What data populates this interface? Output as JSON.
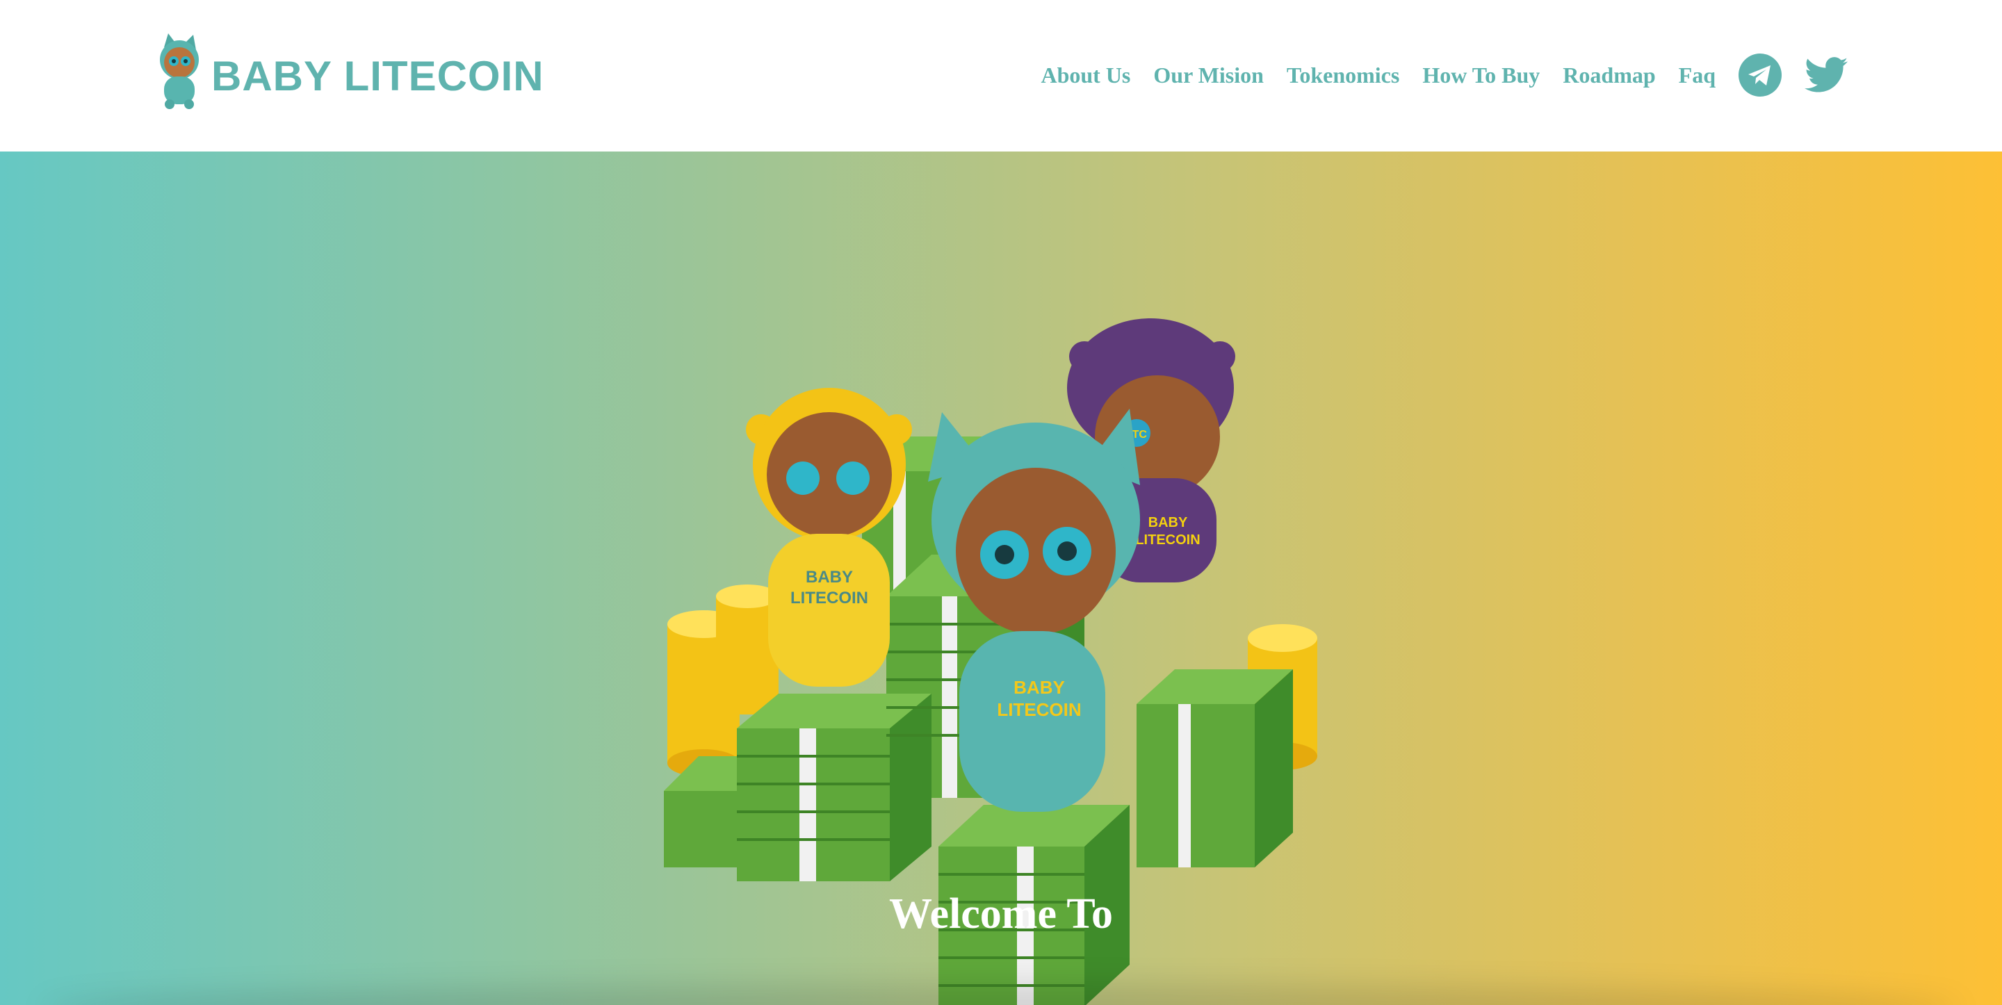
{
  "brand": {
    "name": "BABY LITECOIN",
    "color": "#5fb3ae"
  },
  "nav": {
    "items": [
      {
        "label": "About Us"
      },
      {
        "label": "Our Mision"
      },
      {
        "label": "Tokenomics"
      },
      {
        "label": "How To Buy"
      },
      {
        "label": "Roadmap"
      },
      {
        "label": "Faq"
      }
    ],
    "social": [
      {
        "icon": "telegram-icon"
      },
      {
        "icon": "twitter-icon"
      }
    ]
  },
  "hero": {
    "illustration": {
      "shirt_text": "BABY LITECOIN",
      "eye_text": "LTC"
    },
    "welcome": "Welcome To",
    "gradient": [
      "#66c8c3",
      "#9cc597",
      "#c6c477",
      "#e6c154",
      "#fdc035"
    ]
  }
}
